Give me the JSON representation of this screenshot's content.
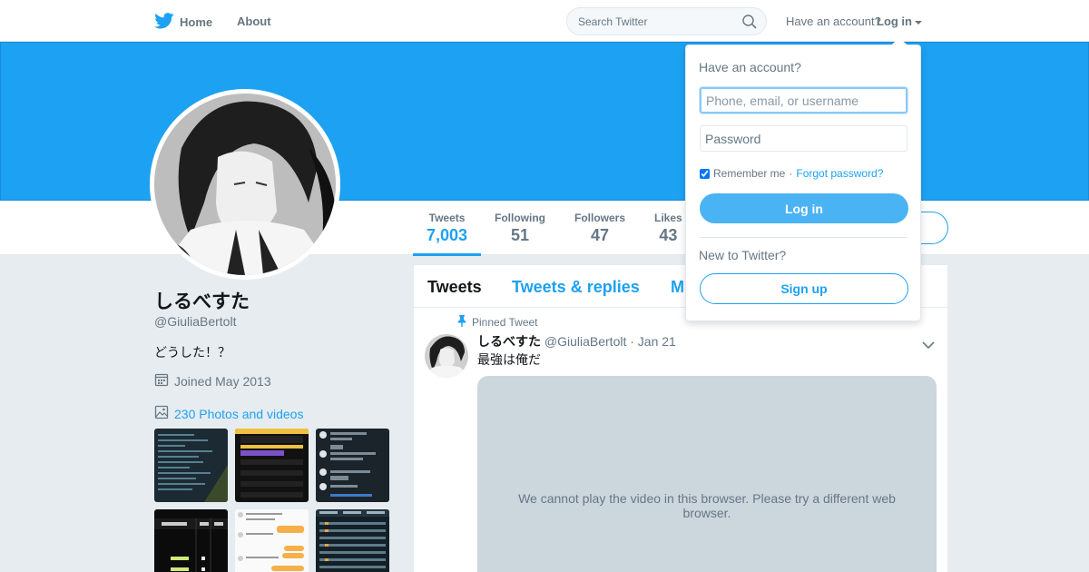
{
  "nav": {
    "home_label": "Home",
    "about_label": "About",
    "search_placeholder": "Search Twitter",
    "have_account": "Have an account?",
    "login_label": "Log in",
    "brand_color": "#1da1f2"
  },
  "profile": {
    "name": "しるべすた",
    "handle": "@GiuliaBertolt",
    "bio": "どうした！？",
    "joined": "Joined May 2013",
    "photos_label": "230 Photos and videos",
    "banner_color": "#1da1f2"
  },
  "stats": [
    {
      "label": "Tweets",
      "value": "7,003"
    },
    {
      "label": "Following",
      "value": "51"
    },
    {
      "label": "Followers",
      "value": "47"
    },
    {
      "label": "Likes",
      "value": "43"
    }
  ],
  "timeline": {
    "tabs": [
      {
        "label": "Tweets"
      },
      {
        "label": "Tweets & replies"
      },
      {
        "label": "M"
      }
    ],
    "pinned_label": "Pinned Tweet",
    "tweet": {
      "name": "しるべすた",
      "handle": "@GiuliaBertolt",
      "date": "· Jan 21",
      "text": "最強は俺だ",
      "video_message": "We cannot play the video in this browser. Please try a different web browser."
    }
  },
  "login_dropdown": {
    "title": "Have an account?",
    "username_placeholder": "Phone, email, or username",
    "password_placeholder": "Password",
    "remember_label": "Remember me",
    "separator": "·",
    "forgot_label": "Forgot password?",
    "login_button": "Log in",
    "new_label": "New to Twitter?",
    "signup_button": "Sign up"
  }
}
